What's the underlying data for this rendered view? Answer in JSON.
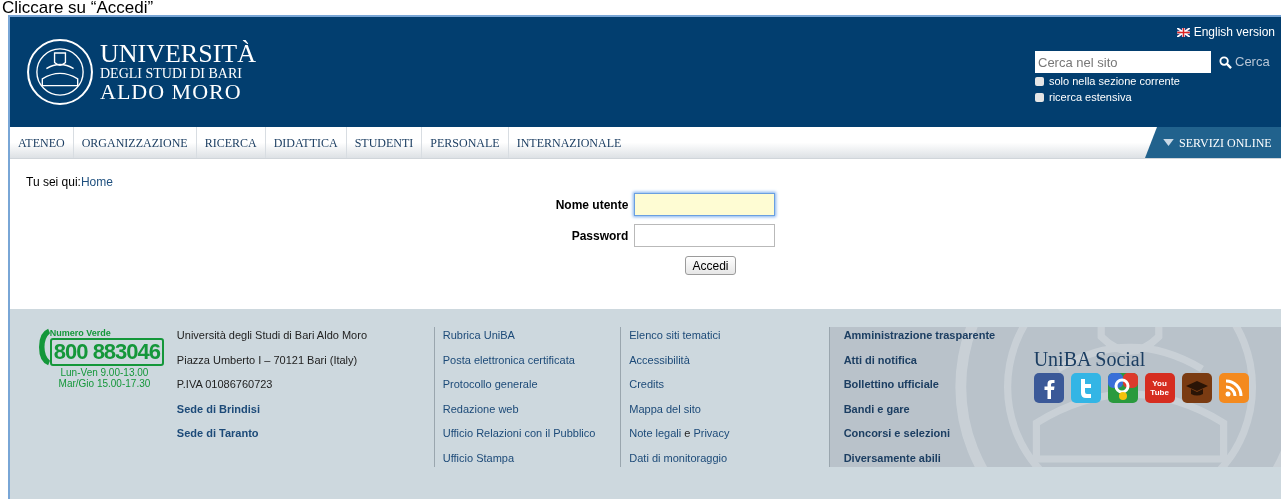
{
  "page_heading": "Cliccare su “Accedi”",
  "header": {
    "logo": {
      "line1": "UNIVERSITÀ",
      "line2": "DEGLI STUDI DI BARI",
      "line3": "ALDO MORO"
    },
    "language_link": "English version",
    "search": {
      "placeholder": "Cerca nel sito",
      "button": "Cerca"
    },
    "options": [
      {
        "label": "solo nella sezione corrente",
        "checked": false
      },
      {
        "label": "ricerca estensiva",
        "checked": false
      }
    ]
  },
  "nav": {
    "items": [
      {
        "label": "ATENEO"
      },
      {
        "label": "ORGANIZZAZIONE"
      },
      {
        "label": "RICERCA"
      },
      {
        "label": "DIDATTICA"
      },
      {
        "label": "STUDENTI"
      },
      {
        "label": "PERSONALE"
      },
      {
        "label": "INTERNAZIONALE"
      }
    ],
    "services": "SERVIZI ONLINE"
  },
  "breadcrumb": {
    "label": "Tu sei qui:",
    "link": "Home"
  },
  "login": {
    "fields": [
      {
        "label": "Nome utente",
        "focused": true
      },
      {
        "label": "Password",
        "focused": false
      }
    ],
    "button": "Accedi"
  },
  "footer": {
    "phone": {
      "caption": "Numero Verde",
      "number": "800 883046",
      "hours": [
        "Lun-Ven 9.00-13.00",
        "Mar/Gio 15.00-17.30"
      ]
    },
    "address": [
      {
        "text": "Università degli Studi di Bari Aldo Moro",
        "kind": "plain"
      },
      {
        "text": "Piazza Umberto I – 70121 Bari (Italy)",
        "kind": "plain"
      },
      {
        "text": "P.IVA 01086760723",
        "kind": "plain"
      },
      {
        "text": "Sede di Brindisi",
        "kind": "link"
      },
      {
        "text": "Sede di Taranto",
        "kind": "link"
      }
    ],
    "links_1": [
      "Rubrica UniBA",
      "Posta elettronica certificata",
      "Protocollo generale",
      "Redazione web",
      "Ufficio Relazioni con il Pubblico",
      "Ufficio Stampa"
    ],
    "links_2": [
      {
        "parts": [
          "Elenco siti tematici"
        ]
      },
      {
        "parts": [
          "Accessibilità"
        ]
      },
      {
        "parts": [
          "Credits"
        ]
      },
      {
        "parts": [
          "Mappa del sito"
        ]
      },
      {
        "parts": [
          "Note legali",
          "e",
          "Privacy"
        ]
      },
      {
        "parts": [
          "Dati di monitoraggio"
        ]
      }
    ],
    "links_3": [
      "Amministrazione trasparente",
      "Atti di notifica",
      "Bollettino ufficiale",
      "Bandi e gare",
      "Concorsi e selezioni",
      "Diversamente abili"
    ],
    "social": {
      "title": "UniBA Social",
      "icons": [
        {
          "kind": "facebook"
        },
        {
          "kind": "twitter"
        },
        {
          "kind": "google"
        },
        {
          "kind": "youtube",
          "text": "You Tube"
        },
        {
          "kind": "academy"
        },
        {
          "kind": "rss"
        }
      ]
    }
  }
}
